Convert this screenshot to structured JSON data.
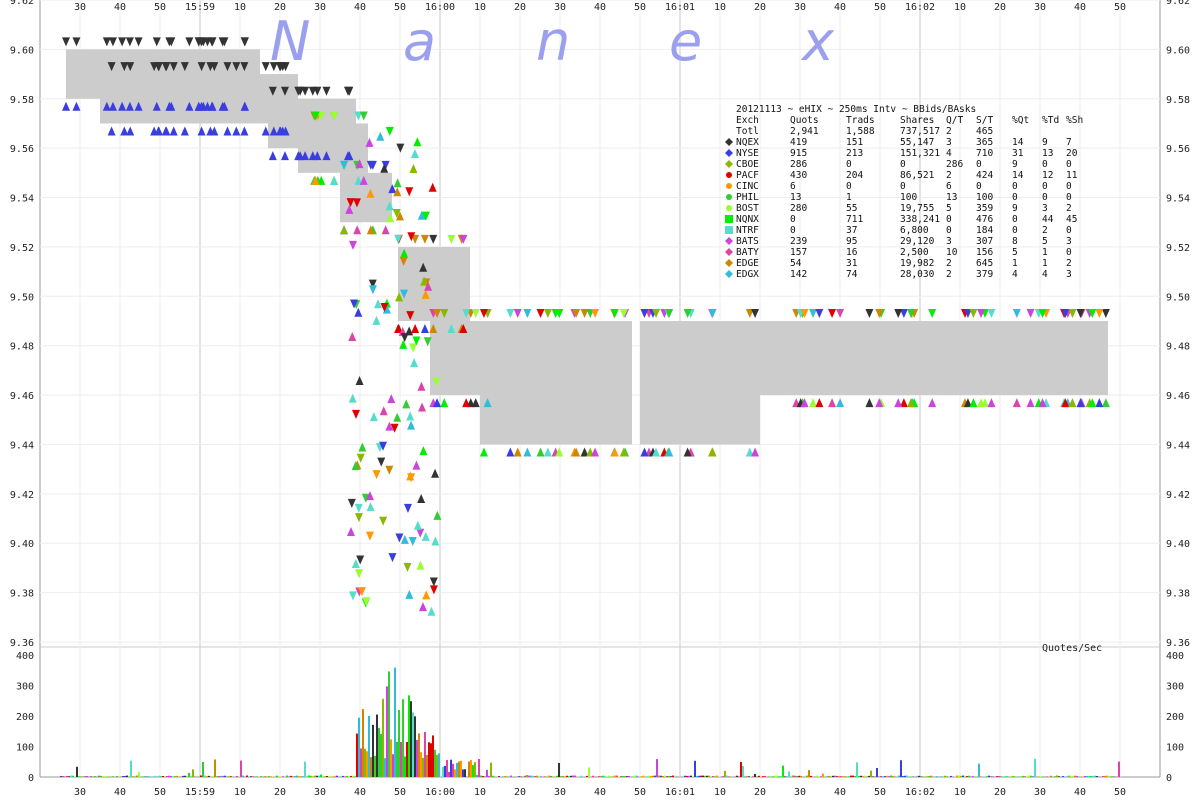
{
  "chart_data": [
    {
      "type": "scatter",
      "title": "",
      "ylim": [
        9.36,
        9.62
      ],
      "y_ticks": [
        "9.62",
        "9.60",
        "9.58",
        "9.56",
        "9.54",
        "9.52",
        "9.50",
        "9.48",
        "9.46",
        "9.44",
        "9.42",
        "9.40",
        "9.38",
        "9.36"
      ],
      "x_ticks": [
        "30",
        "40",
        "50",
        "15:59",
        "10",
        "20",
        "30",
        "40",
        "50",
        "16:00",
        "10",
        "20",
        "30",
        "40",
        "50",
        "16:01",
        "10",
        "20",
        "30",
        "40",
        "50",
        "16:02",
        "10",
        "20",
        "30",
        "40",
        "50"
      ],
      "watermark": [
        "N",
        "a",
        "n",
        "e",
        "x"
      ],
      "legend_header": "20121113 ~ eHIX ~ 250ms Intv ~ BBids/BAsks",
      "legend_columns": [
        "Exch",
        "Quots",
        "Trads",
        "Shares",
        "Q/T",
        "S/T",
        "%Qt",
        "%Td",
        "%Sh"
      ],
      "legend_total": [
        "Totl",
        "2,941",
        "1,588",
        "737,517",
        "2",
        "465",
        "",
        "",
        ""
      ],
      "legend_rows": [
        {
          "exch": "NQEX",
          "color": "#333333",
          "marker": "diamond",
          "values": [
            "419",
            "151",
            "55,147",
            "3",
            "365",
            "14",
            "9",
            "7"
          ]
        },
        {
          "exch": "NYSE",
          "color": "#3a3ee0",
          "marker": "diamond",
          "values": [
            "915",
            "213",
            "151,321",
            "4",
            "710",
            "31",
            "13",
            "20"
          ]
        },
        {
          "exch": "CBOE",
          "color": "#8ab800",
          "marker": "diamond",
          "values": [
            "286",
            "0",
            "0",
            "286",
            "0",
            "9",
            "0",
            "0"
          ]
        },
        {
          "exch": "PACF",
          "color": "#e00000",
          "marker": "circle",
          "values": [
            "430",
            "204",
            "86,521",
            "2",
            "424",
            "14",
            "12",
            "11"
          ]
        },
        {
          "exch": "CINC",
          "color": "#ff9900",
          "marker": "circle",
          "values": [
            "6",
            "0",
            "0",
            "6",
            "0",
            "0",
            "0",
            "0"
          ]
        },
        {
          "exch": "PHIL",
          "color": "#33cc33",
          "marker": "circle",
          "values": [
            "13",
            "1",
            "100",
            "13",
            "100",
            "0",
            "0",
            "0"
          ]
        },
        {
          "exch": "BOST",
          "color": "#99ff33",
          "marker": "circle",
          "values": [
            "280",
            "55",
            "19,755",
            "5",
            "359",
            "9",
            "3",
            "2"
          ]
        },
        {
          "exch": "NQNX",
          "color": "#00ee00",
          "marker": "square",
          "values": [
            "0",
            "711",
            "338,241",
            "0",
            "476",
            "0",
            "44",
            "45"
          ]
        },
        {
          "exch": "NTRF",
          "color": "#55ddcc",
          "marker": "square",
          "values": [
            "0",
            "37",
            "6,800",
            "0",
            "184",
            "0",
            "2",
            "0"
          ]
        },
        {
          "exch": "BATS",
          "color": "#cc44dd",
          "marker": "diamond",
          "values": [
            "239",
            "95",
            "29,120",
            "3",
            "307",
            "8",
            "5",
            "3"
          ]
        },
        {
          "exch": "BATY",
          "color": "#dd44aa",
          "marker": "diamond",
          "values": [
            "157",
            "16",
            "2,500",
            "10",
            "156",
            "5",
            "1",
            "0"
          ]
        },
        {
          "exch": "EDGE",
          "color": "#cc8800",
          "marker": "diamond",
          "values": [
            "54",
            "31",
            "19,982",
            "2",
            "645",
            "1",
            "1",
            "2"
          ]
        },
        {
          "exch": "EDGX",
          "color": "#33bbdd",
          "marker": "diamond",
          "values": [
            "142",
            "74",
            "28,030",
            "2",
            "379",
            "4",
            "4",
            "3"
          ]
        }
      ],
      "nbbo_bands": [
        {
          "t": 0,
          "bid": 9.58,
          "ask": 9.6
        },
        {
          "t": 1,
          "bid": 9.57,
          "ask": 9.59
        },
        {
          "t": 2,
          "bid": 9.56,
          "ask": 9.58
        },
        {
          "t": 3,
          "bid": 9.55,
          "ask": 9.57
        },
        {
          "t": 4,
          "bid": 9.53,
          "ask": 9.55
        },
        {
          "t": 5,
          "bid": 9.49,
          "ask": 9.52
        },
        {
          "t": 6,
          "bid": 9.46,
          "ask": 9.49
        },
        {
          "t": 7,
          "bid": 9.44,
          "ask": 9.49
        },
        {
          "t": 8,
          "bid": 9.44,
          "ask": 9.49
        },
        {
          "t": 9,
          "bid": 9.46,
          "ask": 9.49
        }
      ]
    },
    {
      "type": "bar",
      "title": "Quotes/Sec",
      "ylim": [
        0,
        400
      ],
      "y_ticks": [
        "400",
        "300",
        "200",
        "100",
        "0"
      ],
      "x_ticks": [
        "30",
        "40",
        "50",
        "15:59",
        "10",
        "20",
        "30",
        "40",
        "50",
        "16:00",
        "10",
        "20",
        "30",
        "40",
        "50",
        "16:01",
        "10",
        "20",
        "30",
        "40",
        "50",
        "16:02",
        "10",
        "20",
        "30",
        "40",
        "50"
      ],
      "peak_quotes_per_sec": 380
    }
  ]
}
